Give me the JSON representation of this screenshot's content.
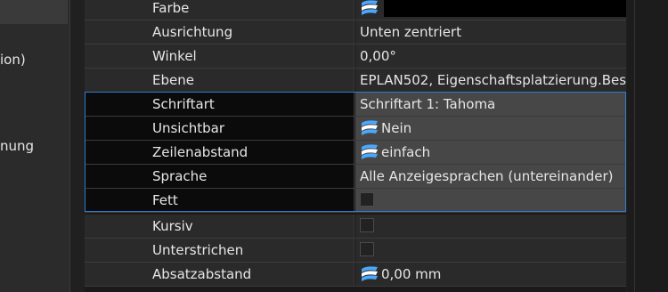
{
  "left_panel": {
    "items": [
      "ion)",
      "nung"
    ]
  },
  "properties": [
    {
      "name": "Farbe",
      "type": "color",
      "value": "",
      "color": "#000000",
      "multi": true
    },
    {
      "name": "Ausrichtung",
      "type": "text",
      "value": "Unten zentriert"
    },
    {
      "name": "Winkel",
      "type": "text",
      "value": "0,00°"
    },
    {
      "name": "Ebene",
      "type": "text",
      "value": "EPLAN502, Eigenschaftsplatzierung.Bes…"
    },
    {
      "name": "Schriftart",
      "type": "text",
      "value": "Schriftart 1: Tahoma"
    },
    {
      "name": "Unsichtbar",
      "type": "multi",
      "value": "Nein"
    },
    {
      "name": "Zeilenabstand",
      "type": "multi",
      "value": "einfach"
    },
    {
      "name": "Sprache",
      "type": "text",
      "value": "Alle Anzeigesprachen (untereinander)"
    },
    {
      "name": "Fett",
      "type": "checkbox",
      "value": "",
      "checked": false
    },
    {
      "name": "Kursiv",
      "type": "checkbox",
      "value": "",
      "checked": false
    },
    {
      "name": "Unterstrichen",
      "type": "checkbox",
      "value": "",
      "checked": false
    },
    {
      "name": "Absatzabstand",
      "type": "multi",
      "value": "0,00 mm"
    }
  ],
  "colors": {
    "selection_border": "#2f7bd0",
    "multi_icon": "#4aa8ff"
  }
}
